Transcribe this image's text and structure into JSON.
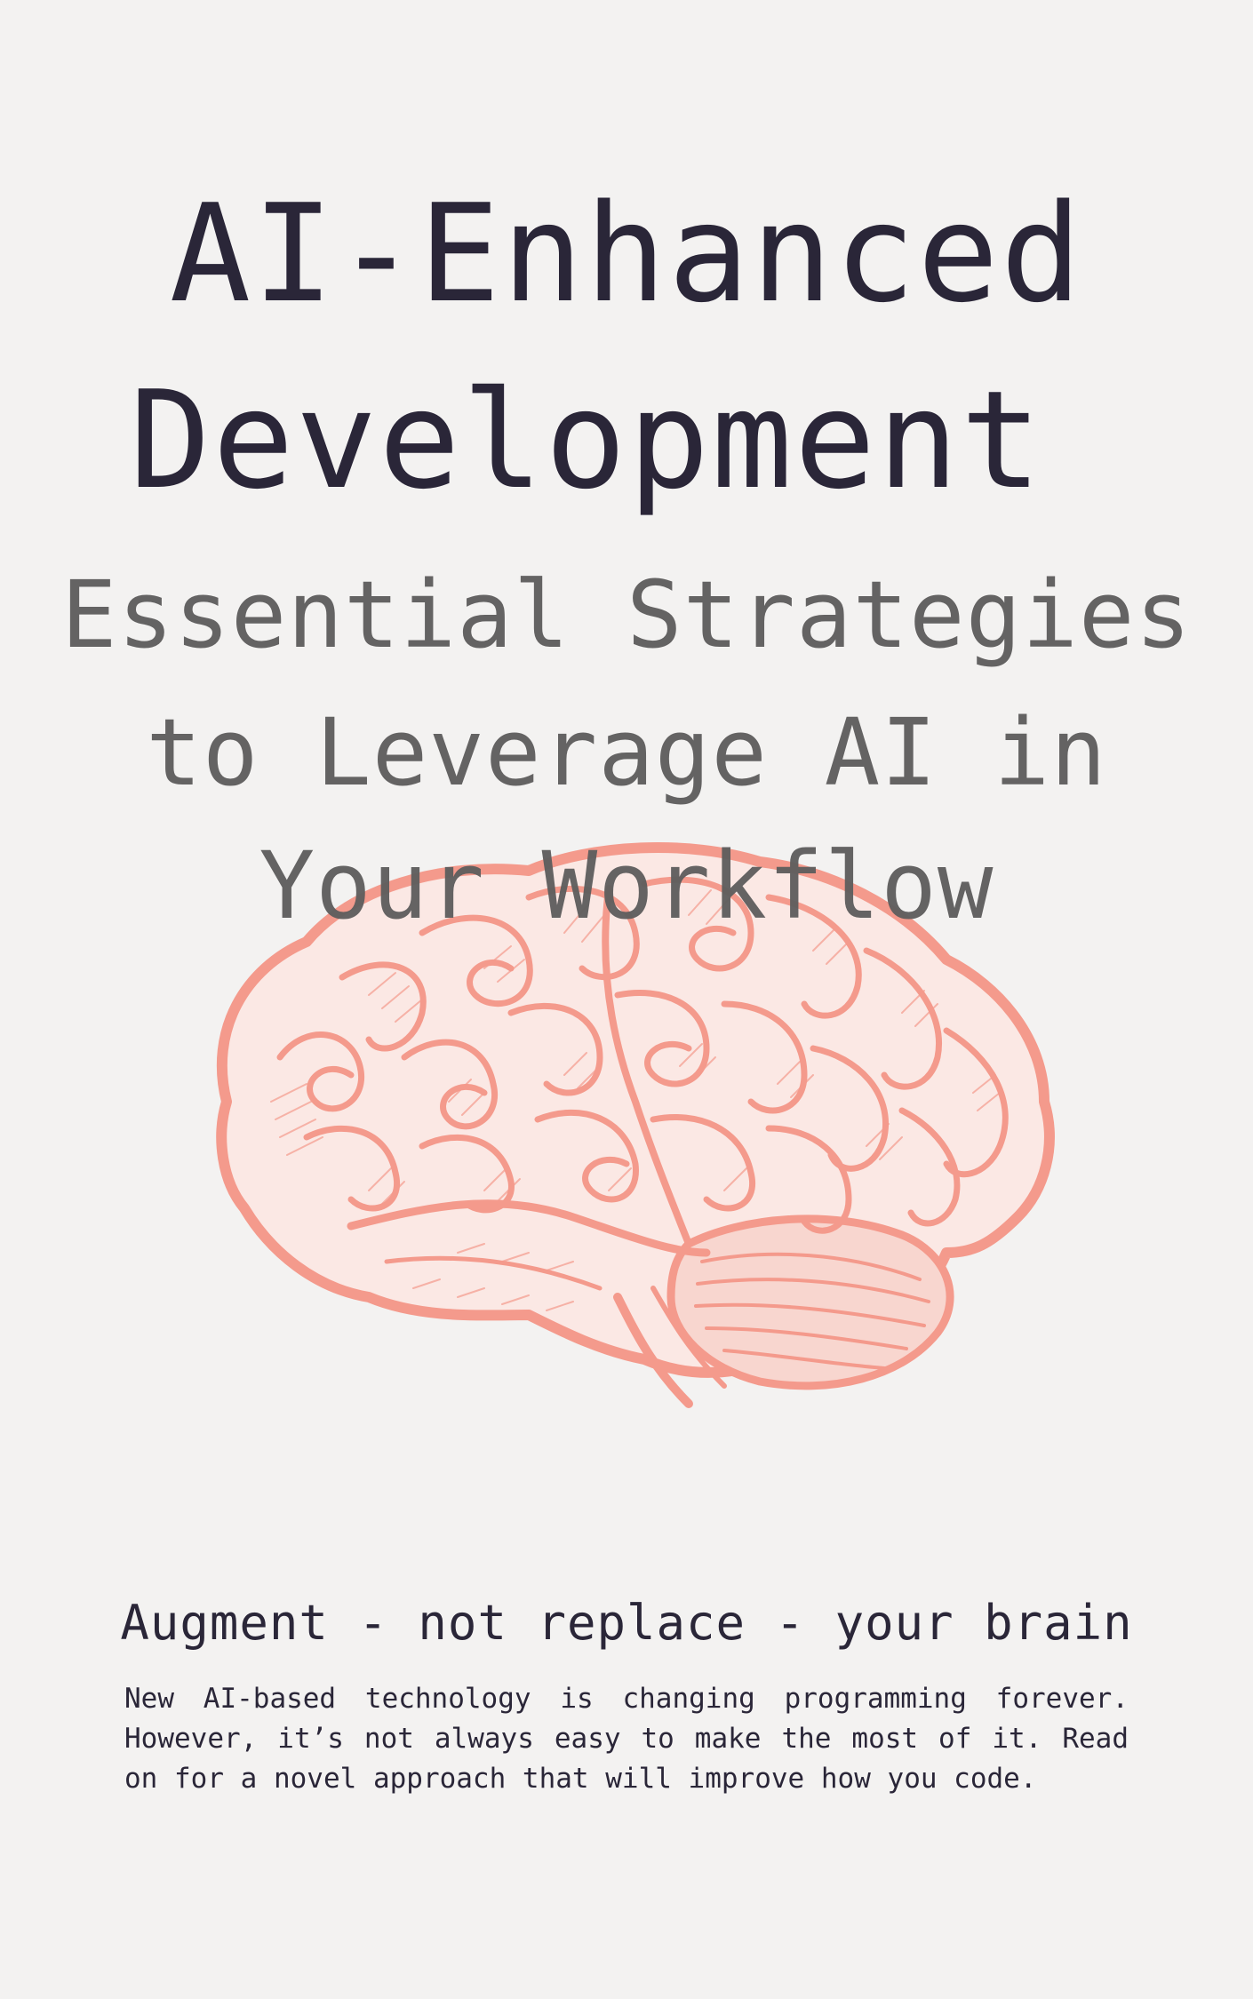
{
  "cover": {
    "title_line1": "AI-Enhanced",
    "title_line2": "Development",
    "subtitle_line1": "Essential Strategies",
    "subtitle_line2": "to Leverage AI in",
    "subtitle_line3": "Your Workflow",
    "tagline": "Augment - not replace - your brain",
    "description": "New AI-based technology is changing programming forever. However, it’s not always easy to make the most of it. Read on for a novel approach that will improve how you code.",
    "illustration": "brain-illustration",
    "colors": {
      "background": "#f3f2f1",
      "title": "#2a2638",
      "subtitle": "#5f5e5e",
      "brain": "#f49a8c"
    }
  }
}
